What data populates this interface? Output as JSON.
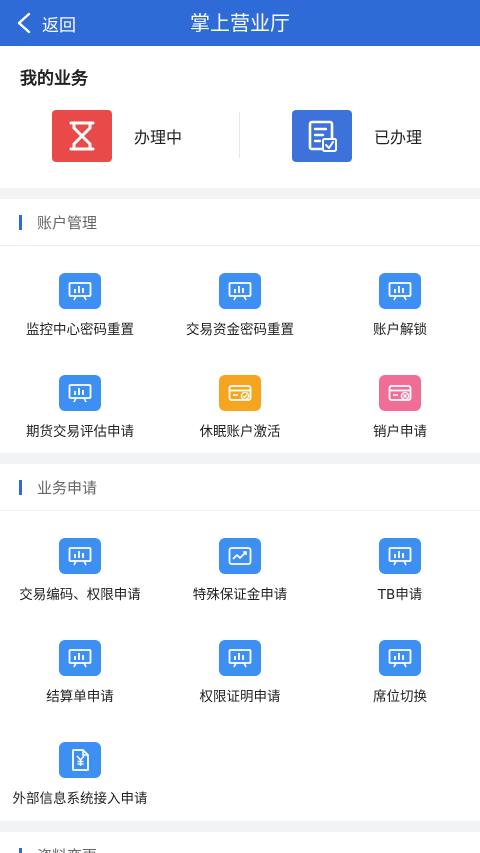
{
  "navbar": {
    "back_label": "返回",
    "title": "掌上营业厅"
  },
  "my_business": {
    "title": "我的业务",
    "in_progress": {
      "label": "办理中",
      "icon": "hourglass-icon",
      "color": "#e84a4a"
    },
    "done": {
      "label": "已办理",
      "icon": "checklist-icon",
      "color": "#3c72d9"
    }
  },
  "sections": [
    {
      "title": "账户管理",
      "items": [
        {
          "label": "监控中心密码重置",
          "icon": "presentation-chart-icon",
          "color": "#3d8ff2"
        },
        {
          "label": "交易资金密码重置",
          "icon": "presentation-chart-icon",
          "color": "#3d8ff2"
        },
        {
          "label": "账户解锁",
          "icon": "presentation-chart-icon",
          "color": "#3d8ff2"
        },
        {
          "label": "期货交易评估申请",
          "icon": "presentation-chart-icon",
          "color": "#3d8ff2"
        },
        {
          "label": "休眠账户激活",
          "icon": "card-check-icon",
          "color": "#f5a61e"
        },
        {
          "label": "销户申请",
          "icon": "card-close-icon",
          "color": "#f06e95"
        }
      ]
    },
    {
      "title": "业务申请",
      "items": [
        {
          "label": "交易编码、权限申请",
          "icon": "presentation-chart-icon",
          "color": "#3d8ff2"
        },
        {
          "label": "特殊保证金申请",
          "icon": "trend-chart-icon",
          "color": "#3d8ff2"
        },
        {
          "label": "TB申请",
          "icon": "presentation-chart-icon",
          "color": "#3d8ff2"
        },
        {
          "label": "结算单申请",
          "icon": "presentation-chart-icon",
          "color": "#3d8ff2"
        },
        {
          "label": "权限证明申请",
          "icon": "presentation-chart-icon",
          "color": "#3d8ff2"
        },
        {
          "label": "席位切换",
          "icon": "presentation-chart-icon",
          "color": "#3d8ff2"
        },
        {
          "label": "外部信息系统接入申请",
          "icon": "yen-document-icon",
          "color": "#3d8ff2"
        }
      ]
    },
    {
      "title": "资料变更"
    }
  ]
}
